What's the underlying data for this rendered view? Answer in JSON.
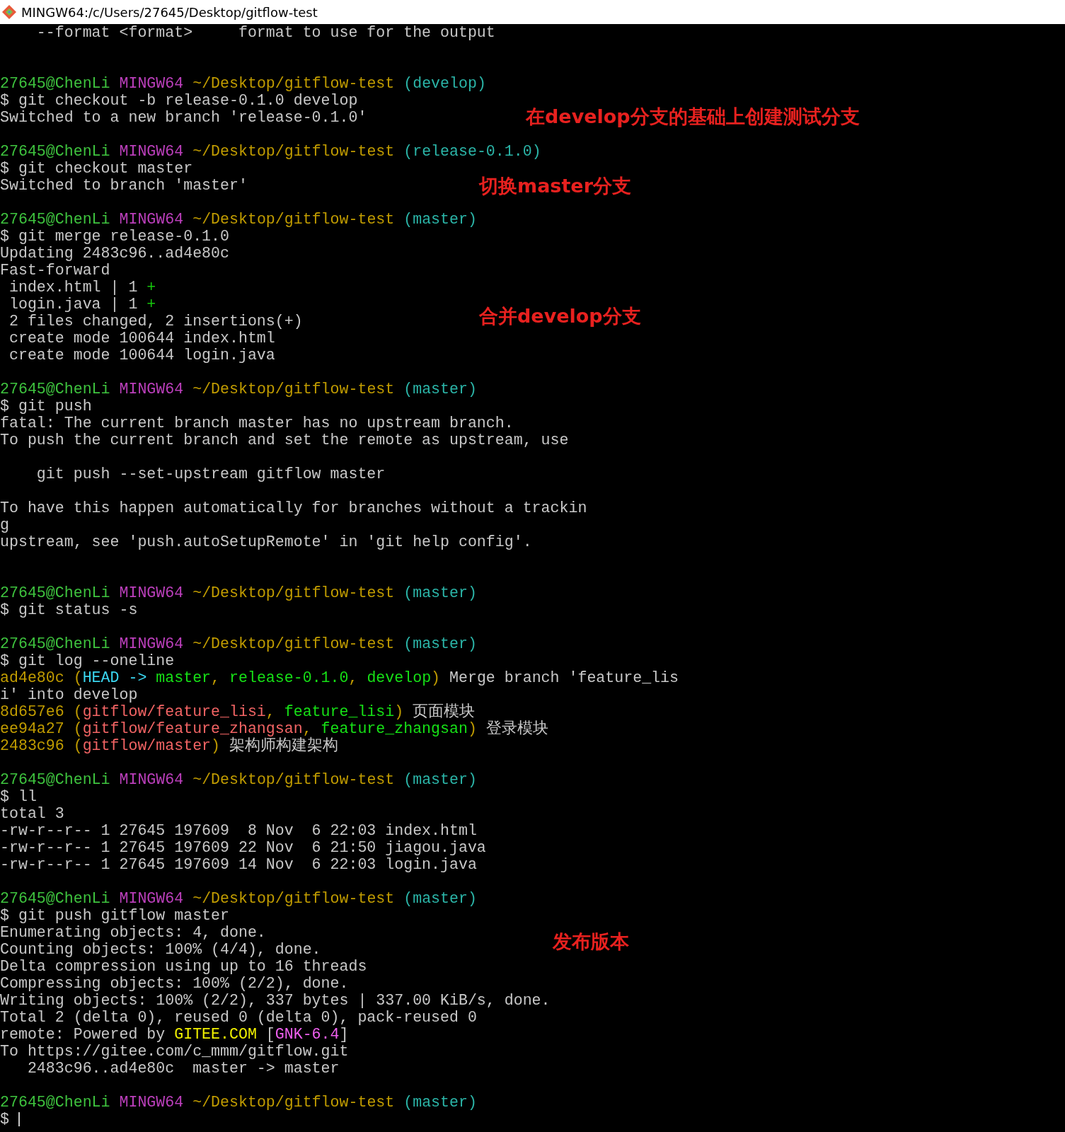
{
  "window": {
    "title": "MINGW64:/c/Users/27645/Desktop/gitflow-test"
  },
  "lines": [
    {
      "kind": "text",
      "segments": [
        {
          "text": "    --format <format>     format to use for the output"
        }
      ]
    },
    {
      "kind": "blank"
    },
    {
      "kind": "blank"
    },
    {
      "kind": "prompt",
      "user": "27645@ChenLi",
      "host": "MINGW64",
      "path": "~/Desktop/gitflow-test",
      "branch": "(develop)"
    },
    {
      "kind": "text",
      "segments": [
        {
          "text": "$ git checkout -b release-0.1.0 develop"
        }
      ]
    },
    {
      "kind": "text",
      "segments": [
        {
          "text": "Switched to a new branch 'release-0.1.0'"
        }
      ],
      "note": "在develop分支的基础上创建测试分支"
    },
    {
      "kind": "blank"
    },
    {
      "kind": "prompt",
      "user": "27645@ChenLi",
      "host": "MINGW64",
      "path": "~/Desktop/gitflow-test",
      "branch": "(release-0.1.0)"
    },
    {
      "kind": "text",
      "segments": [
        {
          "text": "$ git checkout master"
        }
      ]
    },
    {
      "kind": "text",
      "segments": [
        {
          "text": "Switched to branch 'master'"
        }
      ],
      "note": "切换master分支"
    },
    {
      "kind": "blank"
    },
    {
      "kind": "prompt",
      "user": "27645@ChenLi",
      "host": "MINGW64",
      "path": "~/Desktop/gitflow-test",
      "branch": "(master)"
    },
    {
      "kind": "text",
      "segments": [
        {
          "text": "$ git merge release-0.1.0"
        }
      ]
    },
    {
      "kind": "text",
      "segments": [
        {
          "text": "Updating 2483c96..ad4e80c"
        }
      ]
    },
    {
      "kind": "text",
      "segments": [
        {
          "text": "Fast-forward"
        }
      ]
    },
    {
      "kind": "text",
      "segments": [
        {
          "text": " index.html | 1 "
        },
        {
          "text": "+",
          "color": "#16c60c"
        }
      ]
    },
    {
      "kind": "text",
      "segments": [
        {
          "text": " login.java | 1 "
        },
        {
          "text": "+",
          "color": "#16c60c"
        }
      ]
    },
    {
      "kind": "text",
      "segments": [
        {
          "text": " 2 files changed, 2 insertions(+)"
        }
      ],
      "note": "合并develop分支"
    },
    {
      "kind": "text",
      "segments": [
        {
          "text": " create mode 100644 index.html"
        }
      ]
    },
    {
      "kind": "text",
      "segments": [
        {
          "text": " create mode 100644 login.java"
        }
      ]
    },
    {
      "kind": "blank"
    },
    {
      "kind": "prompt",
      "user": "27645@ChenLi",
      "host": "MINGW64",
      "path": "~/Desktop/gitflow-test",
      "branch": "(master)"
    },
    {
      "kind": "text",
      "segments": [
        {
          "text": "$ git push"
        }
      ]
    },
    {
      "kind": "text",
      "segments": [
        {
          "text": "fatal: The current branch master has no upstream branch."
        }
      ]
    },
    {
      "kind": "text",
      "segments": [
        {
          "text": "To push the current branch and set the remote as upstream, use"
        }
      ]
    },
    {
      "kind": "blank"
    },
    {
      "kind": "text",
      "segments": [
        {
          "text": "    git push --set-upstream gitflow master"
        }
      ]
    },
    {
      "kind": "blank"
    },
    {
      "kind": "text",
      "segments": [
        {
          "text": "To have this happen automatically for branches without a trackin"
        }
      ]
    },
    {
      "kind": "text",
      "segments": [
        {
          "text": "g"
        }
      ]
    },
    {
      "kind": "text",
      "segments": [
        {
          "text": "upstream, see 'push.autoSetupRemote' in 'git help config'."
        }
      ]
    },
    {
      "kind": "blank"
    },
    {
      "kind": "blank"
    },
    {
      "kind": "prompt",
      "user": "27645@ChenLi",
      "host": "MINGW64",
      "path": "~/Desktop/gitflow-test",
      "branch": "(master)"
    },
    {
      "kind": "text",
      "segments": [
        {
          "text": "$ git status -s"
        }
      ]
    },
    {
      "kind": "blank"
    },
    {
      "kind": "prompt",
      "user": "27645@ChenLi",
      "host": "MINGW64",
      "path": "~/Desktop/gitflow-test",
      "branch": "(master)"
    },
    {
      "kind": "text",
      "segments": [
        {
          "text": "$ git log --oneline"
        }
      ]
    },
    {
      "kind": "text",
      "segments": [
        {
          "text": "ad4e80c ",
          "color": "#c19c00"
        },
        {
          "text": "(",
          "color": "#c19c00"
        },
        {
          "text": "HEAD -> ",
          "color": "#3ad6f0"
        },
        {
          "text": "master",
          "color": "#16e016"
        },
        {
          "text": ", ",
          "color": "#c19c00"
        },
        {
          "text": "release-0.1.0",
          "color": "#16e016"
        },
        {
          "text": ", ",
          "color": "#c19c00"
        },
        {
          "text": "develop",
          "color": "#16e016"
        },
        {
          "text": ")",
          "color": "#c19c00"
        },
        {
          "text": " Merge branch 'feature_lis"
        }
      ]
    },
    {
      "kind": "text",
      "segments": [
        {
          "text": "i' into develop"
        }
      ]
    },
    {
      "kind": "text",
      "segments": [
        {
          "text": "8d657e6 (",
          "color": "#c19c00"
        },
        {
          "text": "gitflow/feature_lisi",
          "color": "#f26464"
        },
        {
          "text": ", ",
          "color": "#c19c00"
        },
        {
          "text": "feature_lisi",
          "color": "#16e016"
        },
        {
          "text": ")",
          "color": "#c19c00"
        },
        {
          "text": " 页面模块"
        }
      ]
    },
    {
      "kind": "text",
      "segments": [
        {
          "text": "ee94a27 (",
          "color": "#c19c00"
        },
        {
          "text": "gitflow/feature_zhangsan",
          "color": "#f26464"
        },
        {
          "text": ", ",
          "color": "#c19c00"
        },
        {
          "text": "feature_zhangsan",
          "color": "#16e016"
        },
        {
          "text": ")",
          "color": "#c19c00"
        },
        {
          "text": " 登录模块"
        }
      ]
    },
    {
      "kind": "text",
      "segments": [
        {
          "text": "2483c96 (",
          "color": "#c19c00"
        },
        {
          "text": "gitflow/master",
          "color": "#f26464"
        },
        {
          "text": ")",
          "color": "#c19c00"
        },
        {
          "text": " 架构师构建架构"
        }
      ]
    },
    {
      "kind": "blank"
    },
    {
      "kind": "prompt",
      "user": "27645@ChenLi",
      "host": "MINGW64",
      "path": "~/Desktop/gitflow-test",
      "branch": "(master)"
    },
    {
      "kind": "text",
      "segments": [
        {
          "text": "$ ll"
        }
      ]
    },
    {
      "kind": "text",
      "segments": [
        {
          "text": "total 3"
        }
      ]
    },
    {
      "kind": "text",
      "segments": [
        {
          "text": "-rw-r--r-- 1 27645 197609  8 Nov  6 22:03 index.html"
        }
      ]
    },
    {
      "kind": "text",
      "segments": [
        {
          "text": "-rw-r--r-- 1 27645 197609 22 Nov  6 21:50 jiagou.java"
        }
      ]
    },
    {
      "kind": "text",
      "segments": [
        {
          "text": "-rw-r--r-- 1 27645 197609 14 Nov  6 22:03 login.java"
        }
      ]
    },
    {
      "kind": "blank"
    },
    {
      "kind": "prompt",
      "user": "27645@ChenLi",
      "host": "MINGW64",
      "path": "~/Desktop/gitflow-test",
      "branch": "(master)"
    },
    {
      "kind": "text",
      "segments": [
        {
          "text": "$ git push gitflow master"
        }
      ]
    },
    {
      "kind": "text",
      "segments": [
        {
          "text": "Enumerating objects: 4, done."
        }
      ],
      "note": "发布版本"
    },
    {
      "kind": "text",
      "segments": [
        {
          "text": "Counting objects: 100% (4/4), done."
        }
      ]
    },
    {
      "kind": "text",
      "segments": [
        {
          "text": "Delta compression using up to 16 threads"
        }
      ]
    },
    {
      "kind": "text",
      "segments": [
        {
          "text": "Compressing objects: 100% (2/2), done."
        }
      ]
    },
    {
      "kind": "text",
      "segments": [
        {
          "text": "Writing objects: 100% (2/2), 337 bytes | 337.00 KiB/s, done."
        }
      ]
    },
    {
      "kind": "text",
      "segments": [
        {
          "text": "Total 2 (delta 0), reused 0 (delta 0), pack-reused 0"
        }
      ]
    },
    {
      "kind": "text",
      "segments": [
        {
          "text": "remote: Powered by "
        },
        {
          "text": "GITEE.COM",
          "color": "#f0f000"
        },
        {
          "text": " ["
        },
        {
          "text": "GNK-6.4",
          "color": "#f060f0"
        },
        {
          "text": "]"
        }
      ]
    },
    {
      "kind": "text",
      "segments": [
        {
          "text": "To https://gitee.com/c_mmm/gitflow.git"
        }
      ]
    },
    {
      "kind": "text",
      "segments": [
        {
          "text": "   2483c96..ad4e80c  master -> master"
        }
      ]
    },
    {
      "kind": "blank"
    },
    {
      "kind": "prompt",
      "user": "27645@ChenLi",
      "host": "MINGW64",
      "path": "~/Desktop/gitflow-test",
      "branch": "(master)"
    },
    {
      "kind": "input",
      "text": "$ "
    }
  ]
}
